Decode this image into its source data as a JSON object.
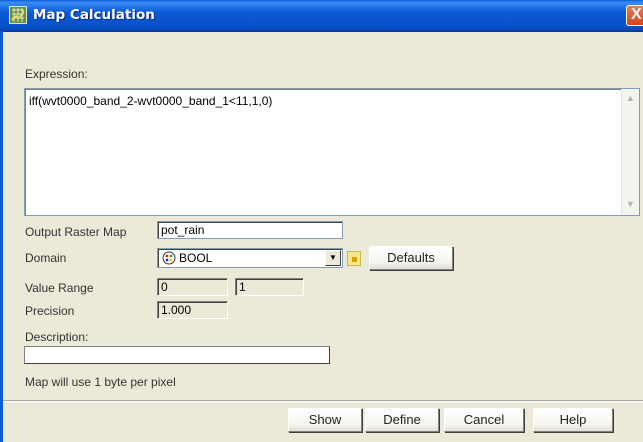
{
  "window": {
    "title": "Map Calculation",
    "close_glyph": "X"
  },
  "expression": {
    "label": "Expression:",
    "value": "iff(wvt0000_band_2-wvt0000_band_1<11,1,0)"
  },
  "output_raster_map": {
    "label": "Output Raster Map",
    "value": "pot_rain"
  },
  "domain": {
    "label": "Domain",
    "selected": "BOOL",
    "icon": "domain-palette-icon"
  },
  "defaults_label": "Defaults",
  "value_range": {
    "label": "Value Range",
    "min": "0",
    "max": "1"
  },
  "precision": {
    "label": "Precision",
    "value": "1.000"
  },
  "description": {
    "label": "Description:",
    "value": ""
  },
  "status_text": "Map will use 1 byte per pixel",
  "buttons": {
    "show": "Show",
    "define": "Define",
    "cancel": "Cancel",
    "help": "Help"
  },
  "colors": {
    "titlebar": "#0b5ad6",
    "dialog_bg": "#ece9d8",
    "close_button": "#d6441c"
  }
}
